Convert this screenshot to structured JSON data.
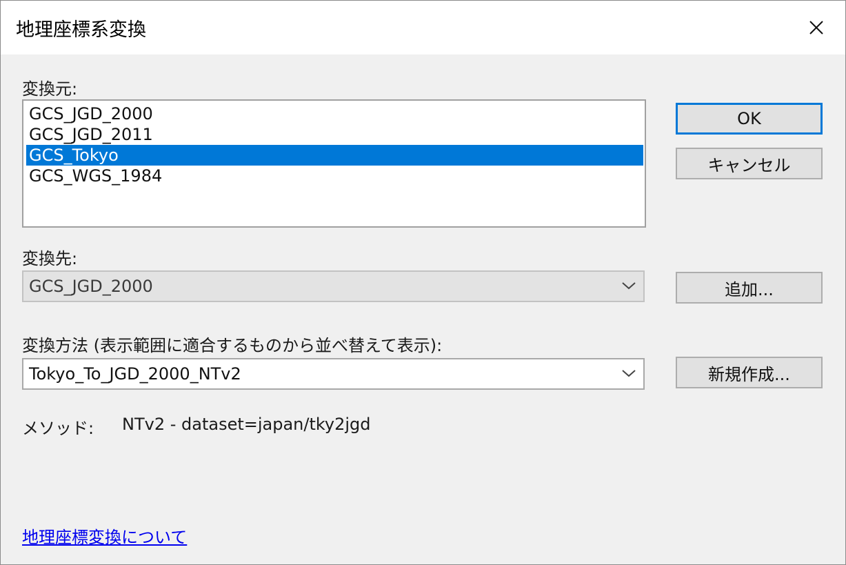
{
  "window": {
    "title": "地理座標系変換",
    "close_icon": "close-icon"
  },
  "source": {
    "label": "変換元:",
    "items": [
      "GCS_JGD_2000",
      "GCS_JGD_2011",
      "GCS_Tokyo",
      "GCS_WGS_1984"
    ],
    "selected_index": 2
  },
  "target": {
    "label": "変換先:",
    "value": "GCS_JGD_2000"
  },
  "method": {
    "label": "変換方法 (表示範囲に適合するものから並べ替えて表示):",
    "value": "Tokyo_To_JGD_2000_NTv2"
  },
  "info": {
    "method_label": "メソッド:",
    "method_value": "NTv2 - dataset=japan/tky2jgd"
  },
  "buttons": {
    "ok": "OK",
    "cancel": "キャンセル",
    "add": "追加...",
    "new": "新規作成..."
  },
  "footer": {
    "help_link": "地理座標変換について"
  },
  "colors": {
    "selection": "#0078d7",
    "link": "#0000ee",
    "dialog_bg": "#f0f0f0"
  }
}
